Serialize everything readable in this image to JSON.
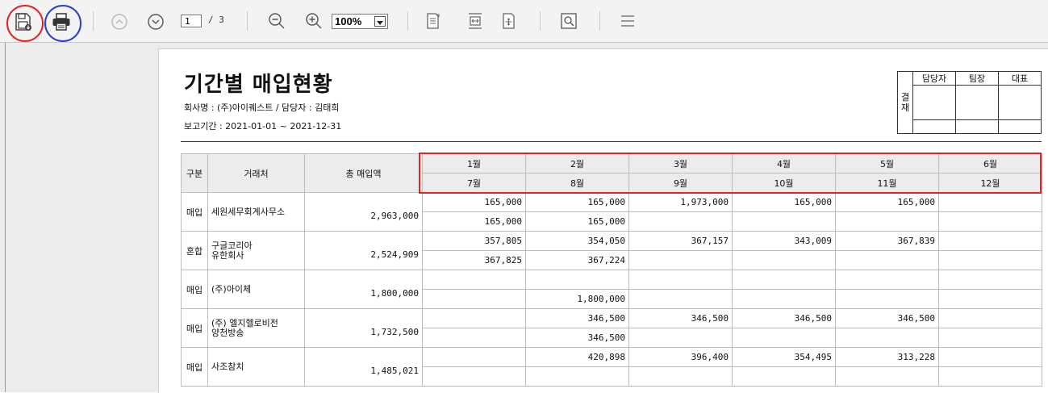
{
  "toolbar": {
    "current_page": "1",
    "page_total": "/ 3",
    "zoom": "100%",
    "icons": [
      "save-icon",
      "print-icon",
      "page-up-icon",
      "page-down-icon",
      "zoom-out-icon",
      "zoom-in-icon",
      "fit-page-icon",
      "fit-width-icon",
      "actual-size-icon",
      "search-icon",
      "menu-icon"
    ],
    "highlight_colors": {
      "save": "#e52222",
      "print": "#2a3dcc"
    }
  },
  "report": {
    "title": "기간별 매입현황",
    "company": "회사명 : (주)아이퀘스트 / 담당자 : 김태희",
    "period": "보고기간 : 2021-01-01 ~ 2021-12-31",
    "approval": {
      "label1": "결",
      "label2": "재",
      "roles": [
        "담당자",
        "팀장",
        "대표"
      ]
    },
    "headers": {
      "category": "구분",
      "vendor": "거래처",
      "total": "총 매입액",
      "months_row1": [
        "1월",
        "2월",
        "3월",
        "4월",
        "5월",
        "6월"
      ],
      "months_row2": [
        "7월",
        "8월",
        "9월",
        "10월",
        "11월",
        "12월"
      ]
    },
    "rows": [
      {
        "category": "매입",
        "vendor": "세원세무회계사무소",
        "total": "2,963,000",
        "row1": [
          "165,000",
          "165,000",
          "1,973,000",
          "165,000",
          "165,000",
          ""
        ],
        "row2": [
          "165,000",
          "165,000",
          "",
          "",
          "",
          ""
        ]
      },
      {
        "category": "혼합",
        "vendor": "구글코리아\n유한회사",
        "total": "2,524,909",
        "row1": [
          "357,805",
          "354,050",
          "367,157",
          "343,009",
          "367,839",
          ""
        ],
        "row2": [
          "367,825",
          "367,224",
          "",
          "",
          "",
          ""
        ]
      },
      {
        "category": "매입",
        "vendor": "(주)아이체",
        "total": "1,800,000",
        "row1": [
          "",
          "",
          "",
          "",
          "",
          ""
        ],
        "row2": [
          "",
          "1,800,000",
          "",
          "",
          "",
          ""
        ]
      },
      {
        "category": "매입",
        "vendor": "(주) 엘지헬로비전\n양천방송",
        "total": "1,732,500",
        "row1": [
          "",
          "346,500",
          "346,500",
          "346,500",
          "346,500",
          ""
        ],
        "row2": [
          "",
          "346,500",
          "",
          "",
          "",
          ""
        ]
      },
      {
        "category": "매입",
        "vendor": "사조참치",
        "total": "1,485,021",
        "row1": [
          "",
          "420,898",
          "396,400",
          "354,495",
          "313,228",
          ""
        ],
        "row2": [
          "",
          "",
          "",
          "",
          "",
          ""
        ]
      }
    ]
  }
}
